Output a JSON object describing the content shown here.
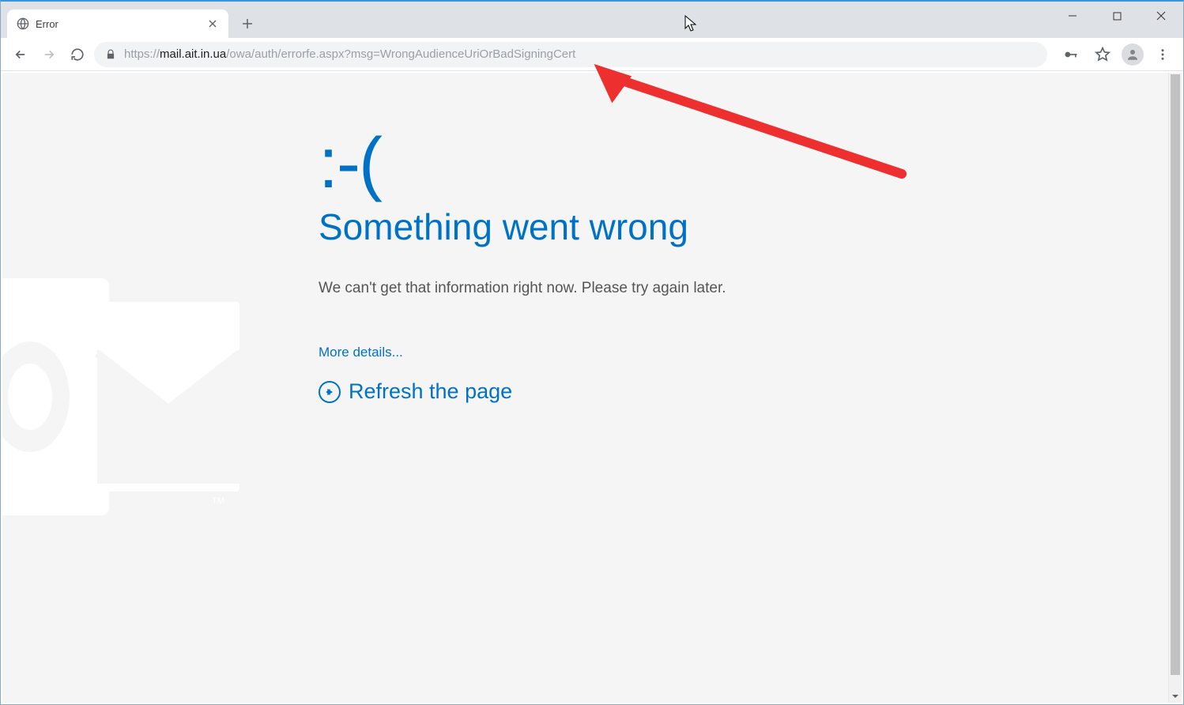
{
  "tab": {
    "title": "Error"
  },
  "address": {
    "scheme": "https://",
    "host": "mail.ait.in.ua",
    "path": "/owa/auth/errorfe.aspx?msg=WrongAudienceUriOrBadSigningCert"
  },
  "error": {
    "sadface": ":-(",
    "heading": "Something went wrong",
    "message": "We can't get that information right now. Please try again later.",
    "more_details": "More details...",
    "refresh": "Refresh the page"
  }
}
